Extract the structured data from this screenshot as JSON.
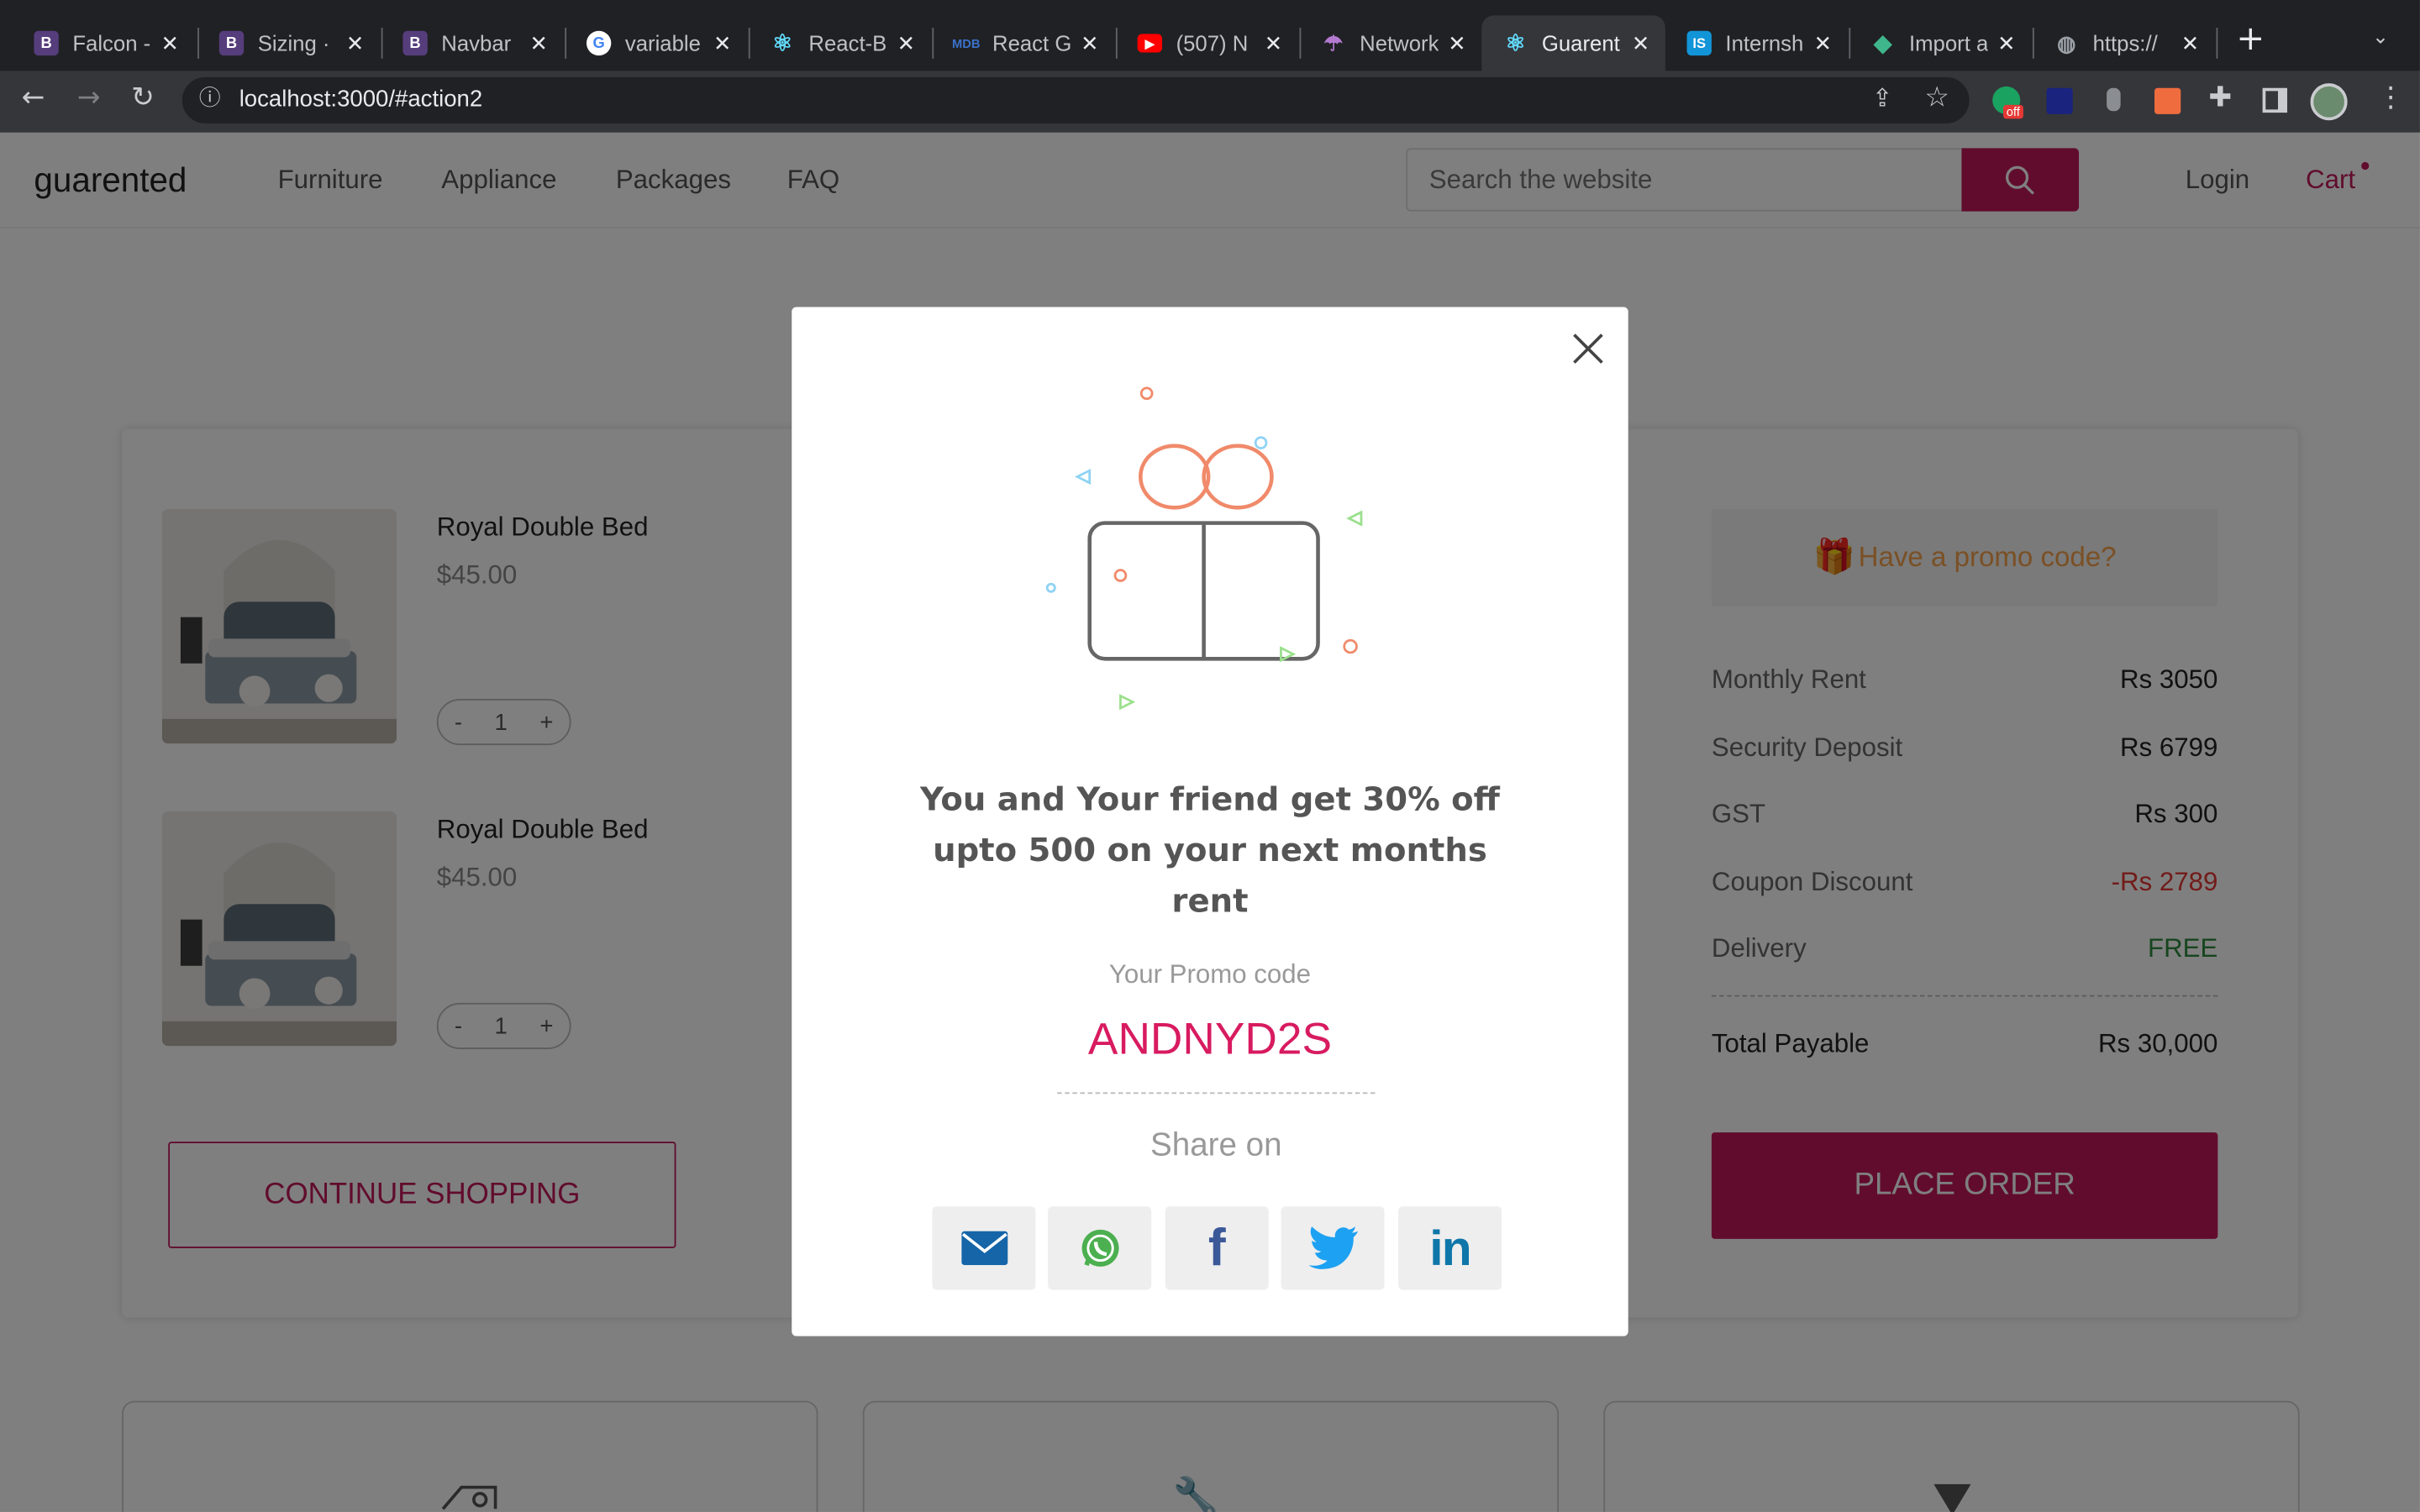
{
  "browser": {
    "tabs": [
      {
        "title": "Falcon -",
        "icon": "bootstrap-icon",
        "active": false
      },
      {
        "title": "Sizing ·",
        "icon": "bootstrap-icon",
        "active": false
      },
      {
        "title": "Navbar",
        "icon": "bootstrap-icon",
        "active": false
      },
      {
        "title": "variable",
        "icon": "google-icon",
        "active": false
      },
      {
        "title": "React-B",
        "icon": "react-icon",
        "active": false
      },
      {
        "title": "React G",
        "icon": "mdb-icon",
        "active": false
      },
      {
        "title": "(507) N",
        "icon": "youtube-icon",
        "active": false
      },
      {
        "title": "Network",
        "icon": "umbrella-icon",
        "active": false
      },
      {
        "title": "Guarent",
        "icon": "react-icon",
        "active": true
      },
      {
        "title": "Internsh",
        "icon": "internshala-icon",
        "active": false
      },
      {
        "title": "Import a",
        "icon": "diamond-icon",
        "active": false
      },
      {
        "title": "https://",
        "icon": "globe-icon",
        "active": false
      }
    ],
    "url": "localhost:3000/#action2",
    "extension_badge": "off"
  },
  "navbar": {
    "brand": "guarented",
    "links": [
      "Furniture",
      "Appliance",
      "Packages",
      "FAQ"
    ],
    "search_placeholder": "Search the website",
    "login": "Login",
    "cart": "Cart"
  },
  "cart": {
    "items": [
      {
        "name": "Royal Double Bed",
        "price": "$45.00",
        "qty": "1"
      },
      {
        "name": "Royal Double Bed",
        "price": "$45.00",
        "qty": "1"
      }
    ],
    "minus": "-",
    "plus": "+",
    "continue_label": "CONTINUE SHOPPING"
  },
  "summary": {
    "promo_label": "Have a promo code?",
    "rows": [
      {
        "label": "Monthly Rent",
        "value": "Rs 3050"
      },
      {
        "label": "Security Deposit",
        "value": "Rs 6799"
      },
      {
        "label": "GST",
        "value": "Rs 300"
      },
      {
        "label": "Coupon Discount",
        "value": "-Rs 2789"
      },
      {
        "label": "Delivery",
        "value": "FREE"
      }
    ],
    "total_label": "Total Payable",
    "total_value": "Rs 30,000",
    "place_order": "PLACE ORDER"
  },
  "modal": {
    "message": "You and Your friend get 30% off upto 500 on your next months rent",
    "promo_caption": "Your Promo code",
    "promo_code": "ANDNYD2S",
    "share_label": "Share on",
    "share_targets": [
      "email-icon",
      "whatsapp-icon",
      "facebook-icon",
      "twitter-icon",
      "linkedin-icon"
    ]
  },
  "colors": {
    "brand": "#c2185b",
    "promo_orange": "#f5a04a",
    "free_green": "#2e8b3e",
    "discount_red": "#e53935",
    "promo_code": "#d81b60"
  }
}
